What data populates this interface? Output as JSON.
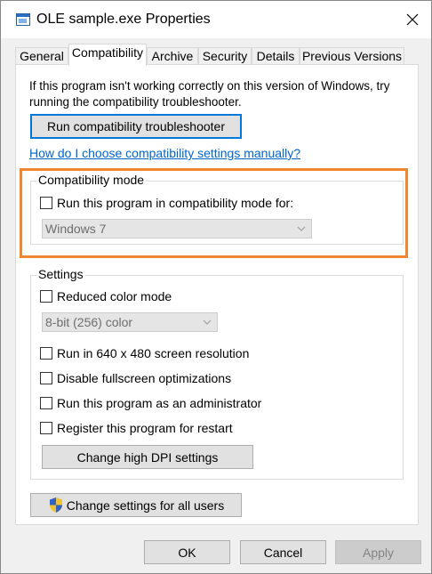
{
  "window": {
    "title": "OLE sample.exe Properties"
  },
  "tabs": [
    {
      "label": "General",
      "active": false
    },
    {
      "label": "Compatibility",
      "active": true
    },
    {
      "label": "Archive",
      "active": false
    },
    {
      "label": "Security",
      "active": false
    },
    {
      "label": "Details",
      "active": false
    },
    {
      "label": "Previous Versions",
      "active": false
    }
  ],
  "intro": {
    "text": "If this program isn't working correctly on this version of Windows, try running the compatibility troubleshooter."
  },
  "troubleshooter_button": "Run compatibility troubleshooter",
  "help_link": "How do I choose compatibility settings manually?",
  "compat_mode": {
    "label": "Compatibility mode",
    "checkbox_label": "Run this program in compatibility mode for:",
    "checked": false,
    "os_selected": "Windows 7",
    "enabled": false
  },
  "settings": {
    "label": "Settings",
    "reduced_color": {
      "label": "Reduced color mode",
      "checked": false
    },
    "color_selected": "8-bit (256) color",
    "res_640": {
      "label": "Run in 640 x 480 screen resolution",
      "checked": false
    },
    "disable_fullscreen": {
      "label": "Disable fullscreen optimizations",
      "checked": false
    },
    "run_as_admin": {
      "label": "Run this program as an administrator",
      "checked": false
    },
    "register_restart": {
      "label": "Register this program for restart",
      "checked": false
    },
    "dpi_button": "Change high DPI settings"
  },
  "all_users_button": "Change settings for all users",
  "footer": {
    "ok": "OK",
    "cancel": "Cancel",
    "apply": "Apply",
    "apply_enabled": false
  },
  "colors": {
    "highlight": "#f0862e",
    "link": "#0066cc",
    "focus": "#0078d7"
  }
}
